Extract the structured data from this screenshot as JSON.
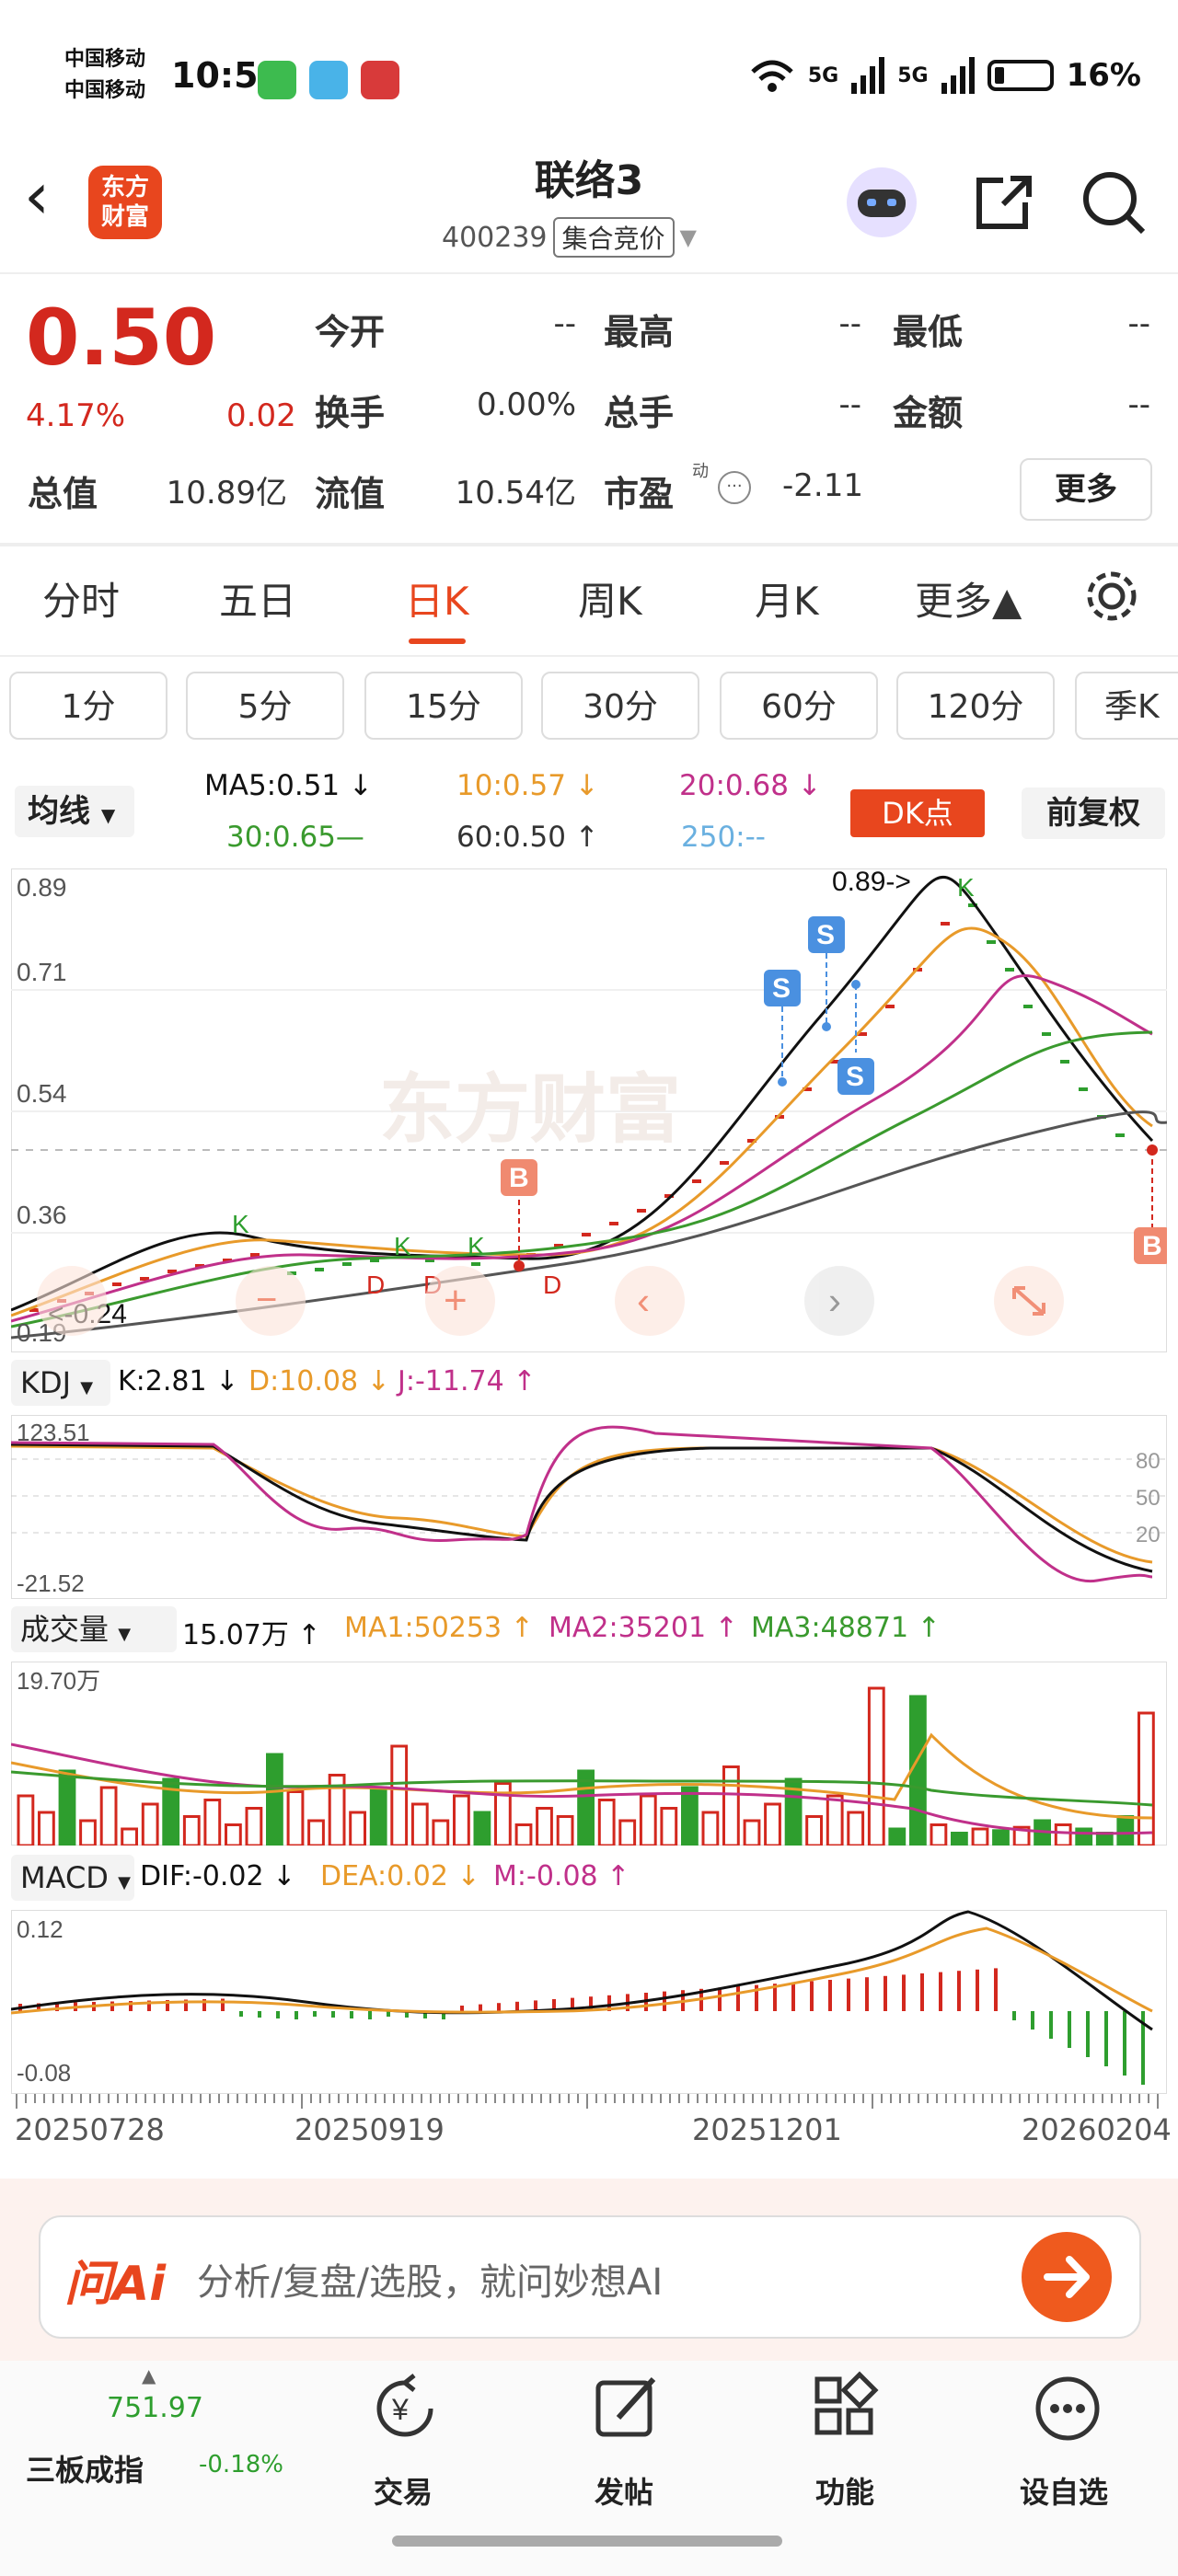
{
  "status_bar": {
    "carrier1": "中国移动",
    "carrier2": "中国移动",
    "time": "10:56",
    "net1": "5G",
    "net2": "5G",
    "battery": "16%"
  },
  "header": {
    "brand": "东方\n财富",
    "stock_name": "联络3",
    "stock_code": "400239",
    "market_tag": "集合竞价"
  },
  "quote": {
    "price": "0.50",
    "change_pct": "4.17%",
    "change": "0.02",
    "rows": [
      [
        {
          "label": "今开",
          "value": "--"
        },
        {
          "label": "最高",
          "value": "--"
        },
        {
          "label": "最低",
          "value": "--"
        }
      ],
      [
        {
          "label": "换手",
          "value": "0.00%"
        },
        {
          "label": "总手",
          "value": "--"
        },
        {
          "label": "金额",
          "value": "--"
        }
      ]
    ],
    "total_value_label": "总值",
    "total_value": "10.89亿",
    "float_value_label": "流值",
    "float_value": "10.54亿",
    "pe_label": "市盈",
    "pe_sup": "动",
    "pe_value": "-2.11",
    "more": "更多"
  },
  "tabs": [
    "分时",
    "五日",
    "日K",
    "周K",
    "月K",
    "更多▲"
  ],
  "periods": [
    "1分",
    "5分",
    "15分",
    "30分",
    "60分",
    "120分",
    "季K"
  ],
  "ma_bar": {
    "selector": "均线",
    "ma5": "MA5:0.51 ↓",
    "ma10": "10:0.57 ↓",
    "ma20": "20:0.68 ↓",
    "ma30": "30:0.65—",
    "ma60": "60:0.50 ↑",
    "ma250": "250:--",
    "dk": "DK点",
    "fq": "前复权"
  },
  "kline": {
    "axis": [
      "0.89",
      "0.71",
      "0.54",
      "0.36",
      "0.19"
    ],
    "high_marker": "0.89->",
    "low_marker": "<-0.24",
    "watermark": "东方财富"
  },
  "kdj": {
    "selector": "KDJ",
    "k": "K:2.81 ↓",
    "d": "D:10.08 ↓",
    "j": "J:-11.74 ↑",
    "top": "123.51",
    "bottom": "-21.52",
    "levels": [
      "80",
      "50",
      "20"
    ]
  },
  "volume": {
    "selector": "成交量",
    "vol": "15.07万 ↑",
    "ma1": "MA1:50253 ↑",
    "ma2": "MA2:35201 ↑",
    "ma3": "MA3:48871 ↑",
    "top": "19.70万"
  },
  "macd": {
    "selector": "MACD",
    "dif": "DIF:-0.02 ↓",
    "dea": "DEA:0.02 ↓",
    "m": "M:-0.08 ↑",
    "top": "0.12",
    "bottom": "-0.08"
  },
  "dates": [
    "20250728",
    "20250919",
    "20251201",
    "20260204"
  ],
  "ai": {
    "logo": "问Ai",
    "placeholder": "分析/复盘/选股，就问妙想AI"
  },
  "nav": {
    "index_value": "751.97",
    "index_name": "三板成指",
    "index_change": "-0.18%",
    "items": [
      "交易",
      "发帖",
      "功能",
      "设自选"
    ]
  },
  "colors": {
    "up": "#d3281e",
    "down": "#2e9e2e",
    "accent": "#e8461e",
    "ma5": "#111111",
    "ma10": "#e89a2a",
    "ma20": "#c0308a",
    "ma30": "#3a9a2e",
    "ma60": "#555555",
    "ma250": "#6ab0e0"
  }
}
